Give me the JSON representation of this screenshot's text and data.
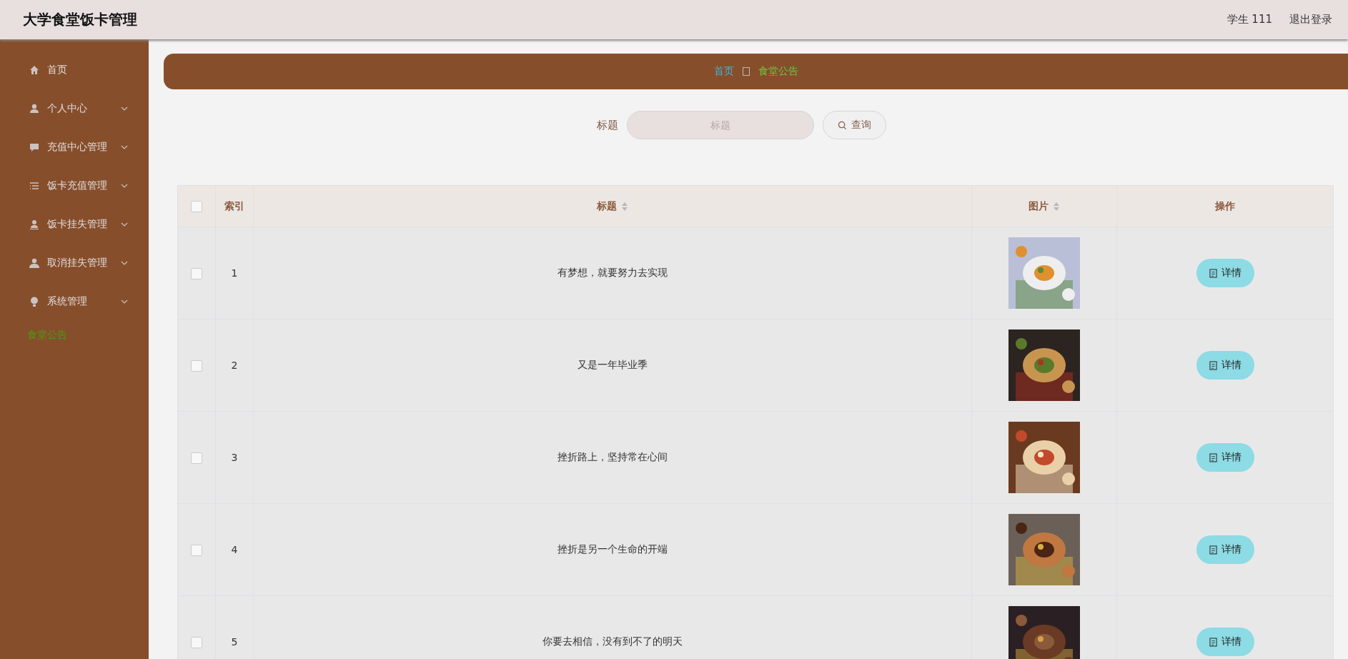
{
  "app_title": "大学食堂饭卡管理",
  "user": {
    "name": "学生 111",
    "logout": "退出登录"
  },
  "sidebar": {
    "items": [
      {
        "label": "首页",
        "kind": "link",
        "selected": false
      },
      {
        "label": "个人中心",
        "kind": "menu",
        "selected": false
      },
      {
        "label": "充值中心管理",
        "kind": "menu",
        "selected": false
      },
      {
        "label": "饭卡充值管理",
        "kind": "menu",
        "selected": false
      },
      {
        "label": "饭卡挂失管理",
        "kind": "menu",
        "selected": false
      },
      {
        "label": "取消挂失管理",
        "kind": "menu",
        "selected": false
      },
      {
        "label": "系统管理",
        "kind": "menu",
        "selected": false
      },
      {
        "label": "食堂公告",
        "kind": "plain",
        "selected": true
      }
    ]
  },
  "breadcrumb": {
    "home": "首页",
    "current": "食堂公告"
  },
  "search": {
    "label": "标题",
    "placeholder": "标题",
    "button": "查询"
  },
  "table": {
    "select_all": {
      "checked": false
    },
    "columns": [
      {
        "label": "索引",
        "sortable": false
      },
      {
        "label": "标题",
        "sortable": true
      },
      {
        "label": "图片",
        "sortable": true
      },
      {
        "label": "操作",
        "sortable": false
      }
    ],
    "rows": [
      {
        "checked": false,
        "index": "1",
        "title": "有梦想，就要努力去实现",
        "action": "详情"
      },
      {
        "checked": false,
        "index": "2",
        "title": "又是一年毕业季",
        "action": "详情"
      },
      {
        "checked": false,
        "index": "3",
        "title": "挫折路上，坚持常在心间",
        "action": "详情"
      },
      {
        "checked": false,
        "index": "4",
        "title": "挫折是另一个生命的开端",
        "action": "详情"
      },
      {
        "checked": false,
        "index": "5",
        "title": "你要去相信，没有到不了的明天",
        "action": "详情"
      }
    ]
  }
}
